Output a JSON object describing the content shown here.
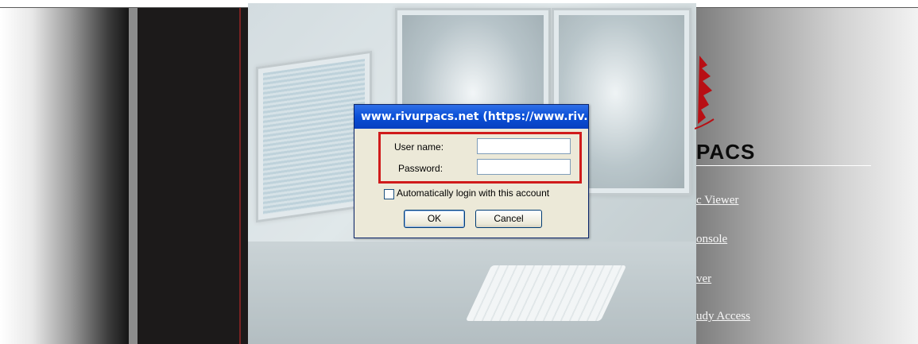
{
  "dialog": {
    "title": "www.rivurpacs.net (https://www.riv...",
    "username_label": "User name:",
    "username_value": "",
    "password_label": "Password:",
    "password_value": "",
    "auto_login_label": "Automatically login with this account",
    "auto_login_checked": false,
    "ok_label": "OK",
    "cancel_label": "Cancel"
  },
  "side": {
    "logo_text": "PACS",
    "links": [
      "c Viewer",
      "onsole",
      "ver",
      "udy Access"
    ]
  },
  "colors": {
    "titlebar": "#0a4fd6",
    "highlight": "#d01b1b",
    "dialog_bg": "#ece9d8"
  },
  "icons": [
    "logo-leaf-icon"
  ]
}
